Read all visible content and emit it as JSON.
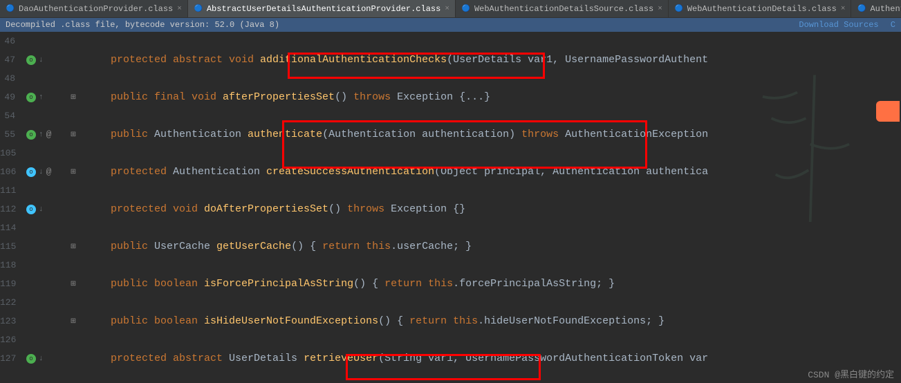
{
  "tabs": [
    {
      "label": "DaoAuthenticationProvider.class",
      "icon": "🔵"
    },
    {
      "label": "AbstractUserDetailsAuthenticationProvider.class",
      "icon": "🔵",
      "active": true
    },
    {
      "label": "WebAuthenticationDetailsSource.class",
      "icon": "🔵"
    },
    {
      "label": "WebAuthenticationDetails.class",
      "icon": "🔵"
    },
    {
      "label": "AuthenticationDetailsSource.class",
      "icon": "🔵"
    }
  ],
  "infobar": {
    "text": "Decompiled .class file, bytecode version: 52.0 (Java 8)",
    "link1": "Download Sources",
    "link2": "C"
  },
  "lines": {
    "l46": "46",
    "l47": "47",
    "l48": "48",
    "l49": "49",
    "l54": "54",
    "l55": "55",
    "l105": "105",
    "l106": "106",
    "l111": "111",
    "l112": "112",
    "l114": "114",
    "l115": "115",
    "l118": "118",
    "l119": "119",
    "l122": "122",
    "l123": "123",
    "l126": "126",
    "l127": "127"
  },
  "code": {
    "l47": {
      "p1": "protected abstract void",
      "p2": " additionalAuthenticationChecks",
      "p3": "(UserDetails var1, UsernamePasswordAuthent"
    },
    "l49": {
      "p1": "public final void",
      "p2": " afterPropertiesSet",
      "p3": "() ",
      "p4": "throws",
      "p5": " Exception ",
      "p6": "{...}"
    },
    "l55": {
      "p1": "public",
      "p2": " Authentication ",
      "p3": "authenticate",
      "p4": "(Authentication authentication) ",
      "p5": "throws",
      "p6": " AuthenticationException"
    },
    "l106": {
      "p1": "protected",
      "p2": " Authentication ",
      "p3": "createSuccessAuthentication",
      "p4": "(Object principal, Authentication authentica"
    },
    "l112": {
      "p1": "protected void",
      "p2": " doAfterPropertiesSet",
      "p3": "() ",
      "p4": "throws",
      "p5": " Exception {}"
    },
    "l115": {
      "p1": "public",
      "p2": " UserCache ",
      "p3": "getUserCache",
      "p4": "() { ",
      "p5": "return this",
      "p6": ".userCache; }"
    },
    "l119": {
      "p1": "public boolean",
      "p2": " isForcePrincipalAsString",
      "p3": "() { ",
      "p4": "return this",
      "p5": ".forcePrincipalAsString; }"
    },
    "l123": {
      "p1": "public boolean",
      "p2": " isHideUserNotFoundExceptions",
      "p3": "() { ",
      "p4": "return this",
      "p5": ".hideUserNotFoundExceptions; }"
    },
    "l127": {
      "p1": "protected abstract",
      "p2": " UserDetails ",
      "p3": "retrieveUser",
      "p4": "(String var1, UsernamePasswordAuthenticationToken var"
    }
  },
  "watermark": "CSDN @黑白键的约定"
}
